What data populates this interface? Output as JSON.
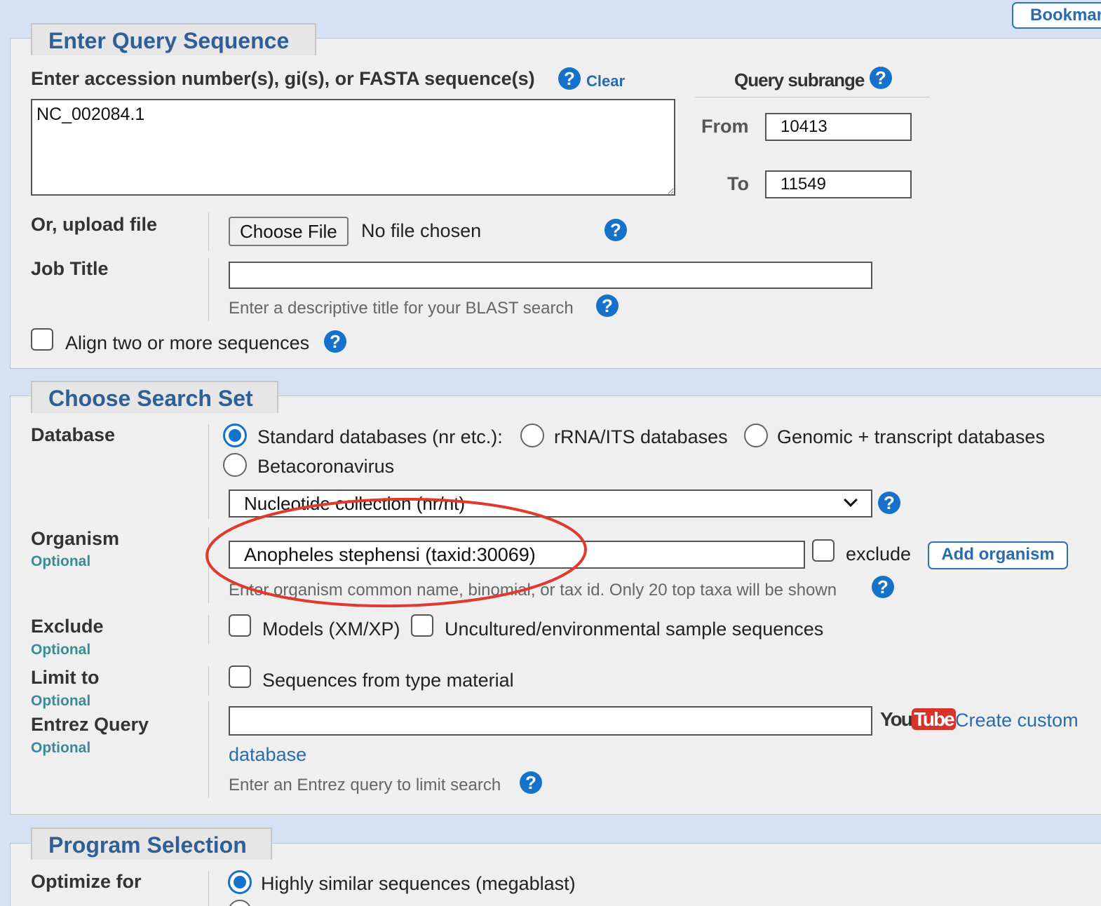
{
  "bookmark": {
    "label": "Bookmark"
  },
  "query": {
    "legend": "Enter Query Sequence",
    "accession_label": "Enter accession number(s), gi(s), or FASTA sequence(s)",
    "clear_label": "Clear",
    "sequence_value": "NC_002084.1",
    "subrange": {
      "title": "Query subrange",
      "from_label": "From",
      "from_value": "10413",
      "to_label": "To",
      "to_value": "11549"
    },
    "upload_label": "Or, upload file",
    "choose_file_label": "Choose File",
    "no_file_text": "No file chosen",
    "job_title_label": "Job Title",
    "job_title_value": "",
    "job_title_hint": "Enter a descriptive title for your BLAST search",
    "align_label": "Align two or more sequences"
  },
  "search_set": {
    "legend": "Choose Search Set",
    "database_label": "Database",
    "db_options": [
      {
        "label": "Standard databases (nr etc.):",
        "checked": true
      },
      {
        "label": "rRNA/ITS databases",
        "checked": false
      },
      {
        "label": "Genomic + transcript databases",
        "checked": false
      },
      {
        "label": "Betacoronavirus",
        "checked": false
      }
    ],
    "db_select_value": "Nucleotide collection (nr/nt)",
    "organism_label": "Organism",
    "optional_label": "Optional",
    "organism_value": "Anopheles stephensi (taxid:30069)",
    "exclude_checkbox_label": "exclude",
    "add_organism_label": "Add organism",
    "organism_hint": "Enter organism common name, binomial, or tax id. Only 20 top taxa will be shown",
    "exclude_label": "Exclude",
    "models_label": "Models (XM/XP)",
    "uncultured_label": "Uncultured/environmental sample sequences",
    "limit_label": "Limit to",
    "type_material_label": "Sequences from type material",
    "entrez_label": "Entrez Query",
    "entrez_value": "",
    "youtube_you": "You",
    "youtube_tube": "Tube",
    "create_custom_label": "Create custom",
    "database_link_label": "database",
    "entrez_hint": "Enter an Entrez query to limit search",
    "annotation_color": "#e03a2e"
  },
  "program": {
    "legend": "Program Selection",
    "optimize_label": "Optimize for",
    "options": [
      {
        "label": "Highly similar sequences (megablast)",
        "checked": true
      }
    ]
  },
  "help_icon_label": "?"
}
